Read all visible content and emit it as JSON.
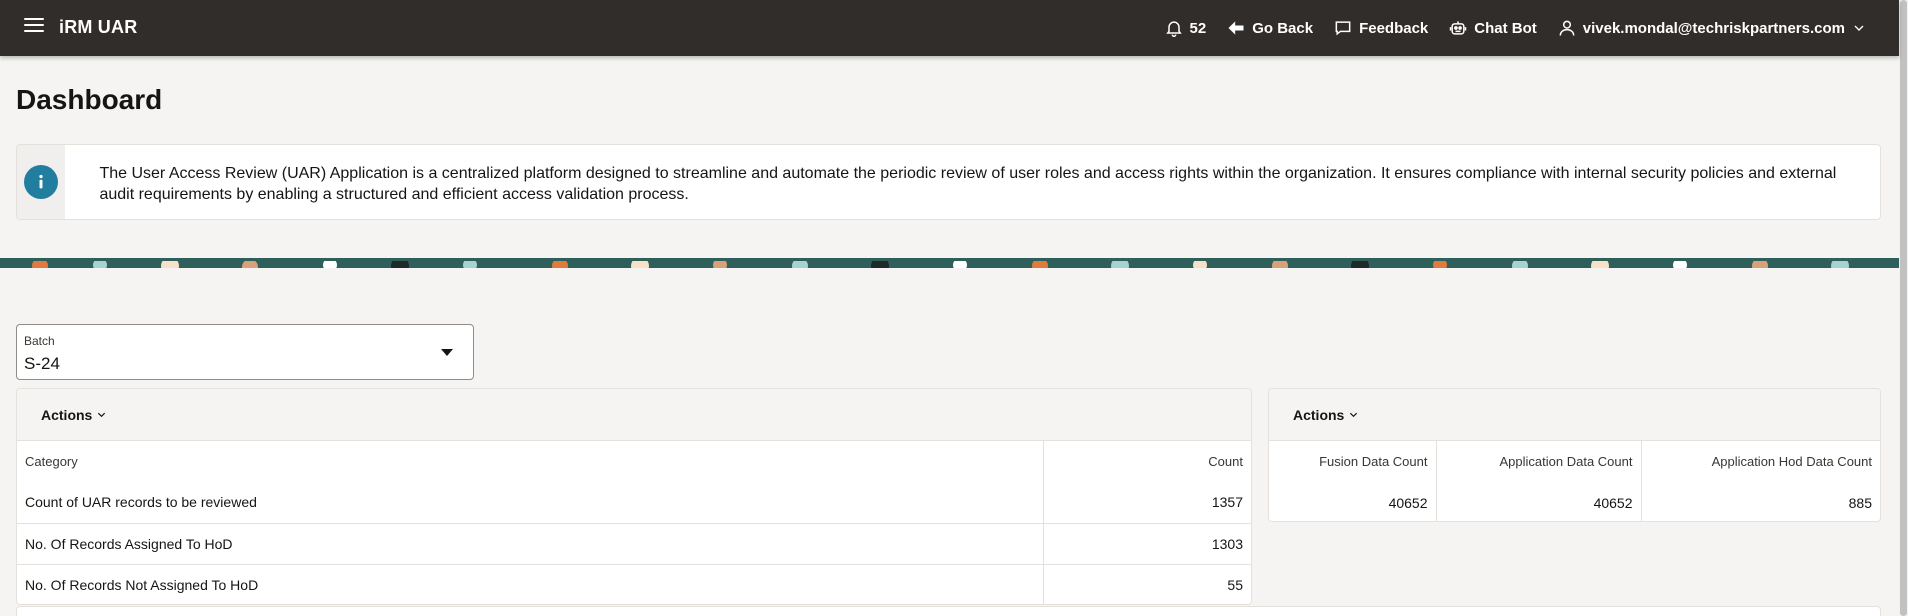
{
  "header": {
    "app_title": "iRM UAR",
    "notification_count": "52",
    "go_back_label": "Go Back",
    "feedback_label": "Feedback",
    "chatbot_label": "Chat Bot",
    "user_email": "vivek.mondal@techriskpartners.com"
  },
  "page": {
    "title": "Dashboard",
    "info_text": "The User Access Review (UAR) Application is a centralized platform designed to streamline and automate the periodic review of user roles and access rights within the organization. It ensures compliance with internal security policies and external audit requirements by enabling a structured and efficient access validation process."
  },
  "batch": {
    "label": "Batch",
    "value": "S-24"
  },
  "summary_panel": {
    "actions_label": "Actions",
    "columns": [
      "Category",
      "Count"
    ],
    "rows": [
      {
        "category": "Count of UAR records to be reviewed",
        "count": "1357"
      },
      {
        "category": "No. Of Records Assigned To HoD",
        "count": "1303"
      },
      {
        "category": "No. Of Records Not Assigned To HoD",
        "count": "55"
      }
    ]
  },
  "counts_panel": {
    "actions_label": "Actions",
    "columns": [
      "Fusion Data Count",
      "Application Data Count",
      "Application Hod Data Count"
    ],
    "values": [
      "40652",
      "40652",
      "885"
    ]
  },
  "colors": {
    "header_bg": "#312d2a",
    "info_accent": "#227e9e",
    "page_bg": "#f5f4f2"
  }
}
